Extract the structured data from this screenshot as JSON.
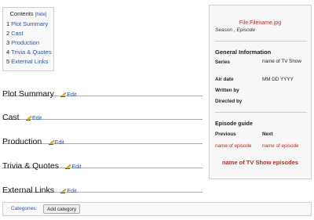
{
  "toc": {
    "title": "Contents",
    "hide_label": "[hide]",
    "items": [
      {
        "num": "1",
        "label": "Plot Summary"
      },
      {
        "num": "2",
        "label": "Cast"
      },
      {
        "num": "3",
        "label": "Production"
      },
      {
        "num": "4",
        "label": "Trivia & Quotes"
      },
      {
        "num": "5",
        "label": "External Links"
      }
    ]
  },
  "sections": [
    {
      "title": "Plot Summary",
      "edit": "Edit"
    },
    {
      "title": "Cast",
      "edit": "Edit"
    },
    {
      "title": "Production",
      "edit": "Edit"
    },
    {
      "title": "Trivia & Quotes",
      "edit": "Edit"
    },
    {
      "title": "External Links",
      "edit": "Edit"
    }
  ],
  "infobox": {
    "file_link": "File:Filename.jpg",
    "caption": "Season , Episode",
    "general_heading": "General Information",
    "rows": [
      {
        "label": "Series",
        "value": "name of TV Show"
      },
      {
        "label": "Air date",
        "value": "MM DD YYYY"
      },
      {
        "label": "Written by",
        "value": ""
      },
      {
        "label": "Directed by",
        "value": ""
      }
    ],
    "guide_heading": "Episode guide",
    "previous_label": "Previous",
    "next_label": "Next",
    "previous_link": "name of episode",
    "next_link": "name of episode",
    "all_episodes_link": "name of TV Show episodes"
  },
  "categories": {
    "label": "Categories:",
    "add_button": "Add category"
  },
  "colors": {
    "link": "#2a55b0",
    "redlink": "#c0281c"
  }
}
